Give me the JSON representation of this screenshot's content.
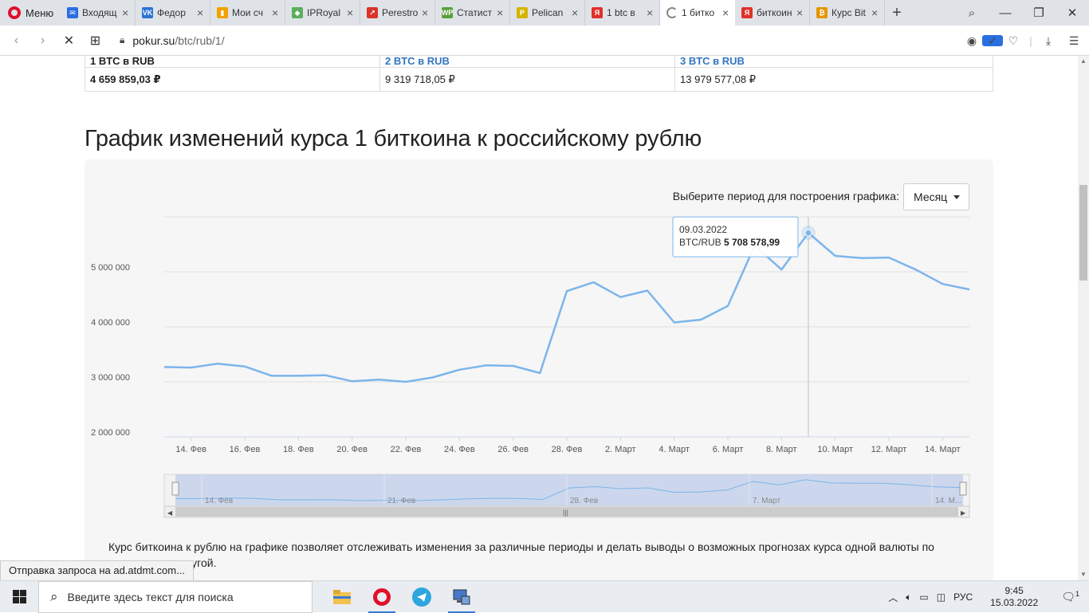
{
  "browser": {
    "menu_label": "Меню",
    "tabs": [
      {
        "label": "Входящ",
        "color": "#2a6fe0",
        "glyph": "✉"
      },
      {
        "label": "Федор",
        "color": "#2a74d6",
        "glyph": "VK"
      },
      {
        "label": "Мои сч",
        "color": "#f2a100",
        "glyph": "▮"
      },
      {
        "label": "IPRoyal",
        "color": "#5cae5c",
        "glyph": "◆"
      },
      {
        "label": "Perestro",
        "color": "#d9332a",
        "glyph": "↗"
      },
      {
        "label": "Статист",
        "color": "#59a03a",
        "glyph": "WP"
      },
      {
        "label": "Pelican",
        "color": "#d4b400",
        "glyph": "P"
      },
      {
        "label": "1 btc в",
        "color": "#e0302a",
        "glyph": "Я"
      },
      {
        "label": "1 битко",
        "color": "#888888",
        "glyph": ""
      },
      {
        "label": "биткоин",
        "color": "#e0302a",
        "glyph": "Я"
      },
      {
        "label": "Курс Bit",
        "color": "#e69500",
        "glyph": "₿"
      }
    ],
    "active_tab_index": 8,
    "url_domain": "pokur.su",
    "url_path": "/btc/rub/1/"
  },
  "conversion": {
    "head": [
      "1 BTC в RUB",
      "2 BTC в RUB",
      "3 BTC в RUB"
    ],
    "values": [
      "4 659 859,03 ₽",
      "9 319 718,05 ₽",
      "13 979 577,08 ₽"
    ]
  },
  "page_title": "График изменений курса 1 биткоина к российскому рублю",
  "period": {
    "label": "Выберите период для построения графика:",
    "selected": "Месяц"
  },
  "tooltip": {
    "date": "09.03.2022",
    "series": "BTC/RUB",
    "value": "5 708 578,99"
  },
  "chart_data": {
    "type": "line",
    "series": [
      {
        "name": "BTC/RUB",
        "x": [
          "13.02",
          "14.02",
          "15.02",
          "16.02",
          "17.02",
          "18.02",
          "19.02",
          "20.02",
          "21.02",
          "22.02",
          "23.02",
          "24.02",
          "25.02",
          "26.02",
          "27.02",
          "28.02",
          "01.03",
          "02.03",
          "03.03",
          "04.03",
          "05.03",
          "06.03",
          "07.03",
          "08.03",
          "09.03",
          "10.03",
          "11.03",
          "12.03",
          "13.03",
          "14.03",
          "15.03"
        ],
        "values": [
          3270000,
          3260000,
          3330000,
          3280000,
          3110000,
          3110000,
          3120000,
          3010000,
          3040000,
          3000000,
          3080000,
          3220000,
          3300000,
          3290000,
          3160000,
          4650000,
          4810000,
          4540000,
          4660000,
          4080000,
          4130000,
          4380000,
          5480000,
          5040000,
          5708578.99,
          5290000,
          5250000,
          5260000,
          5040000,
          4780000,
          4680000
        ],
        "color": "#7cb5ec"
      }
    ],
    "y_ticks": [
      "2 000 000",
      "3 000 000",
      "4 000 000",
      "5 000 000"
    ],
    "x_ticks": [
      "14. Фев",
      "16. Фев",
      "18. Фев",
      "20. Фев",
      "22. Фев",
      "24. Фев",
      "26. Фев",
      "28. Фев",
      "2. Март",
      "4. Март",
      "6. Март",
      "8. Март",
      "10. Март",
      "12. Март",
      "14. Март"
    ],
    "navigator_ticks": [
      "14. Фев",
      "21. Фев",
      "28. Фев",
      "7. Март",
      "14. М..."
    ],
    "ylim": [
      2000000,
      6000000
    ],
    "grid": true
  },
  "description": "Курс биткоина к рублю на графике позволяет отслеживать изменения за различные периоды и делать выводы о возможных прогнозах курса одной валюты по отношению к другой.",
  "status_text": "Отправка запроса на ad.atdmt.com...",
  "taskbar": {
    "search_placeholder": "Введите здесь текст для поиска",
    "lang": "РУС",
    "time": "9:45",
    "date": "15.03.2022",
    "notification_count": "1"
  }
}
